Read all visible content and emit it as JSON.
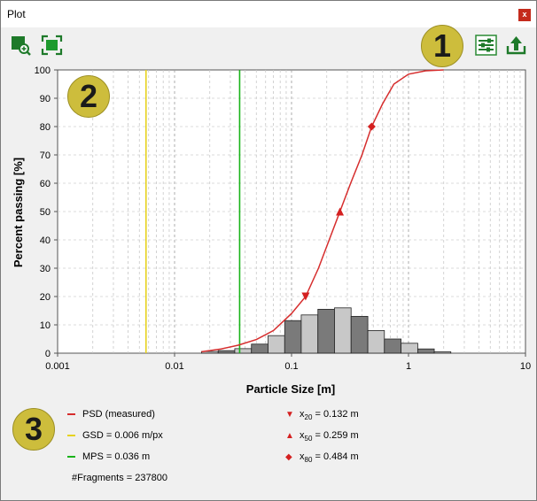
{
  "window": {
    "title": "Plot",
    "close_label": "x"
  },
  "toolbar": {
    "left_buttons": [
      "zoom-in-icon",
      "fit-view-icon"
    ],
    "right_buttons": [
      "settings-sliders-icon",
      "export-upload-icon"
    ]
  },
  "badges": [
    "1",
    "2",
    "3"
  ],
  "colors": {
    "psd": "#d62d2d",
    "gsd": "#e6d21e",
    "mps": "#19b319",
    "bar_dark": "#7a7a7a",
    "bar_light": "#c8c8c8",
    "badge": "#cdbd3c"
  },
  "chart_data": {
    "type": "line",
    "xlabel": "Particle Size [m]",
    "ylabel": "Percent passing [%]",
    "x_scale": "log",
    "xlim": [
      0.001,
      10
    ],
    "ylim": [
      0,
      100
    ],
    "x_ticks": [
      0.001,
      0.01,
      0.1,
      1,
      10
    ],
    "x_tick_labels": [
      "0.001",
      "0.01",
      "0.1",
      "1",
      "10"
    ],
    "y_ticks": [
      0,
      10,
      20,
      30,
      40,
      50,
      60,
      70,
      80,
      90,
      100
    ],
    "grid": true,
    "series": [
      {
        "name": "PSD (measured)",
        "x": [
          0.017,
          0.025,
          0.035,
          0.05,
          0.07,
          0.1,
          0.132,
          0.17,
          0.21,
          0.259,
          0.32,
          0.4,
          0.484,
          0.6,
          0.75,
          1.0,
          1.4,
          2.0
        ],
        "y": [
          0.5,
          1.5,
          2.8,
          4.8,
          8,
          14,
          20,
          30,
          40,
          50,
          60,
          70,
          80,
          88,
          95,
          98.5,
          99.7,
          100
        ]
      }
    ],
    "vertical_lines": [
      {
        "name": "GSD = 0.006 m/px",
        "x": 0.0057
      },
      {
        "name": "MPS = 0.036 m",
        "x": 0.036
      }
    ],
    "histogram": {
      "edges": [
        0.017,
        0.0236,
        0.0327,
        0.0454,
        0.063,
        0.0874,
        0.121,
        0.168,
        0.233,
        0.323,
        0.449,
        0.622,
        0.864,
        1.2,
        1.66,
        2.3
      ],
      "values": [
        0.6,
        0.9,
        1.6,
        3.2,
        6.2,
        11.5,
        13.5,
        15.5,
        16,
        13,
        8,
        5,
        3.5,
        1.5,
        0.5
      ],
      "shades": [
        "light",
        "dark",
        "light",
        "dark",
        "light",
        "dark",
        "light",
        "dark",
        "light",
        "dark",
        "light",
        "dark",
        "light",
        "dark",
        "light"
      ]
    },
    "markers": [
      {
        "label": "x20 = 0.132 m",
        "x": 0.132,
        "y": 20,
        "shape": "triangle-down"
      },
      {
        "label": "x50 = 0.259 m",
        "x": 0.259,
        "y": 50,
        "shape": "triangle-up"
      },
      {
        "label": "x80 = 0.484 m",
        "x": 0.484,
        "y": 80,
        "shape": "diamond"
      }
    ],
    "annotations": {
      "fragments": "#Fragments = 237800"
    }
  },
  "legend": {
    "psd": "PSD (measured)",
    "gsd": "GSD = 0.006 m/px",
    "mps": "MPS = 0.036 m",
    "fragments": "#Fragments = 237800",
    "x20": {
      "sym": "x",
      "sub": "20",
      "val": " = 0.132 m"
    },
    "x50": {
      "sym": "x",
      "sub": "50",
      "val": " = 0.259 m"
    },
    "x80": {
      "sym": "x",
      "sub": "80",
      "val": " = 0.484 m"
    }
  }
}
